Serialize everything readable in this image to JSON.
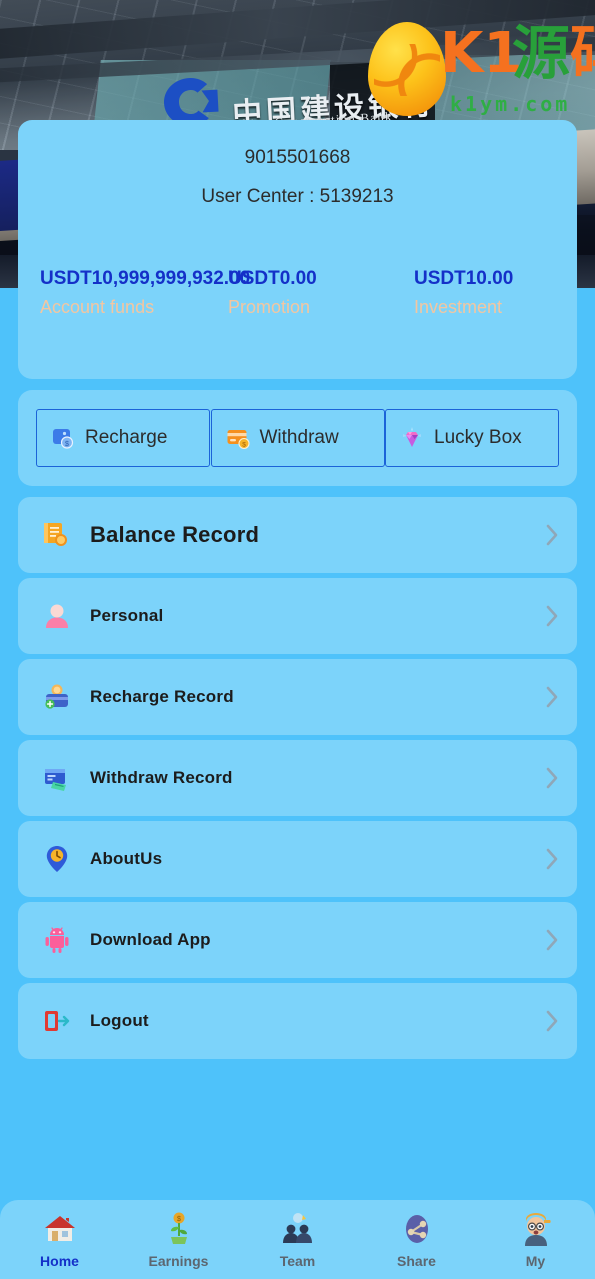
{
  "header": {
    "photo_alt": "china-construction-bank-building-photo",
    "bank_cn": "中国建设银行",
    "bank_en": "China Construction Bank",
    "watermark": {
      "brand_k1": "K1",
      "brand_cn_1": "源",
      "brand_cn_2": "码",
      "domain": "k1ym.com",
      "color_orange": "#F5711F",
      "color_green": "#28A03A"
    }
  },
  "profile": {
    "user_id": "9015501668",
    "user_center_label": "User Center : 5139213",
    "balances": [
      {
        "value": "USDT10,999,999,932.00",
        "label": "Account funds"
      },
      {
        "value": "USDT0.00",
        "label": "Promotion"
      },
      {
        "value": "USDT10.00",
        "label": "Investment"
      }
    ],
    "value_color": "#1430C8",
    "label_color": "#F3C6A0"
  },
  "quick_actions": [
    {
      "label": "Recharge",
      "icon": "recharge-icon"
    },
    {
      "label": "Withdraw",
      "icon": "withdraw-card-icon"
    },
    {
      "label": "Lucky Box",
      "icon": "lucky-box-gem-icon"
    }
  ],
  "menu": [
    {
      "label": "Balance Record",
      "icon": "balance-record-icon",
      "emphasis": true
    },
    {
      "label": "Personal",
      "icon": "personal-avatar-icon",
      "emphasis": false
    },
    {
      "label": "Recharge Record",
      "icon": "recharge-record-icon",
      "emphasis": false
    },
    {
      "label": "Withdraw Record",
      "icon": "withdraw-record-icon",
      "emphasis": false
    },
    {
      "label": "AboutUs",
      "icon": "about-us-pin-icon",
      "emphasis": false
    },
    {
      "label": "Download App",
      "icon": "android-robot-icon",
      "emphasis": false
    },
    {
      "label": "Logout",
      "icon": "logout-door-icon",
      "emphasis": false
    }
  ],
  "bottom_nav": {
    "active_index": 0,
    "active_color": "#1430C8",
    "inactive_color": "#5C6670",
    "items": [
      {
        "label": "Home",
        "icon": "house-icon"
      },
      {
        "label": "Earnings",
        "icon": "money-plant-icon"
      },
      {
        "label": "Team",
        "icon": "team-people-icon"
      },
      {
        "label": "Share",
        "icon": "share-node-icon"
      },
      {
        "label": "My",
        "icon": "user-face-icon"
      }
    ]
  },
  "theme": {
    "page_background": "#4EC2FA",
    "card_background": "#7CD3FA",
    "text_dark": "#1C1C1C"
  }
}
